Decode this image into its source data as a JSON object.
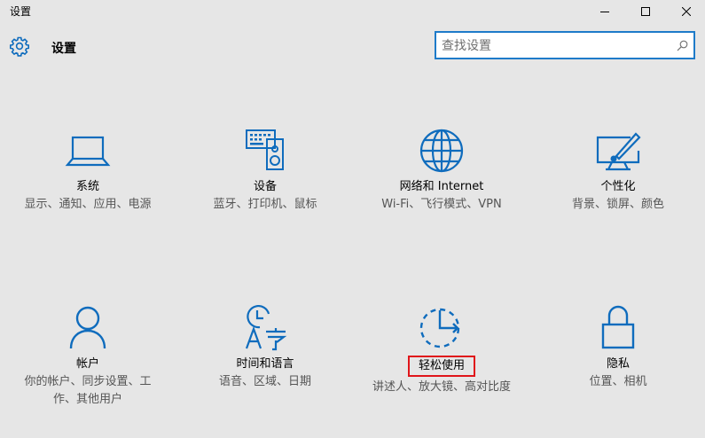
{
  "window": {
    "title": "设置"
  },
  "header": {
    "title": "设置"
  },
  "search": {
    "placeholder": "查找设置",
    "value": ""
  },
  "colors": {
    "accent": "#0f6cbd",
    "highlight_border": "#e0151a",
    "search_border": "#1e7bc9"
  },
  "tiles": [
    {
      "icon": "laptop-icon",
      "name": "系统",
      "desc": "显示、通知、应用、电源"
    },
    {
      "icon": "devices-icon",
      "name": "设备",
      "desc": "蓝牙、打印机、鼠标"
    },
    {
      "icon": "globe-icon",
      "name": "网络和 Internet",
      "desc": "Wi-Fi、飞行模式、VPN"
    },
    {
      "icon": "personalization-icon",
      "name": "个性化",
      "desc": "背景、锁屏、颜色"
    },
    {
      "icon": "person-icon",
      "name": "帐户",
      "desc": "你的帐户、同步设置、工作、其他用户"
    },
    {
      "icon": "time-language-icon",
      "name": "时间和语言",
      "desc": "语音、区域、日期"
    },
    {
      "icon": "ease-of-access-icon",
      "name": "轻松使用",
      "desc": "讲述人、放大镜、高对比度"
    },
    {
      "icon": "lock-icon",
      "name": "隐私",
      "desc": "位置、相机"
    }
  ]
}
